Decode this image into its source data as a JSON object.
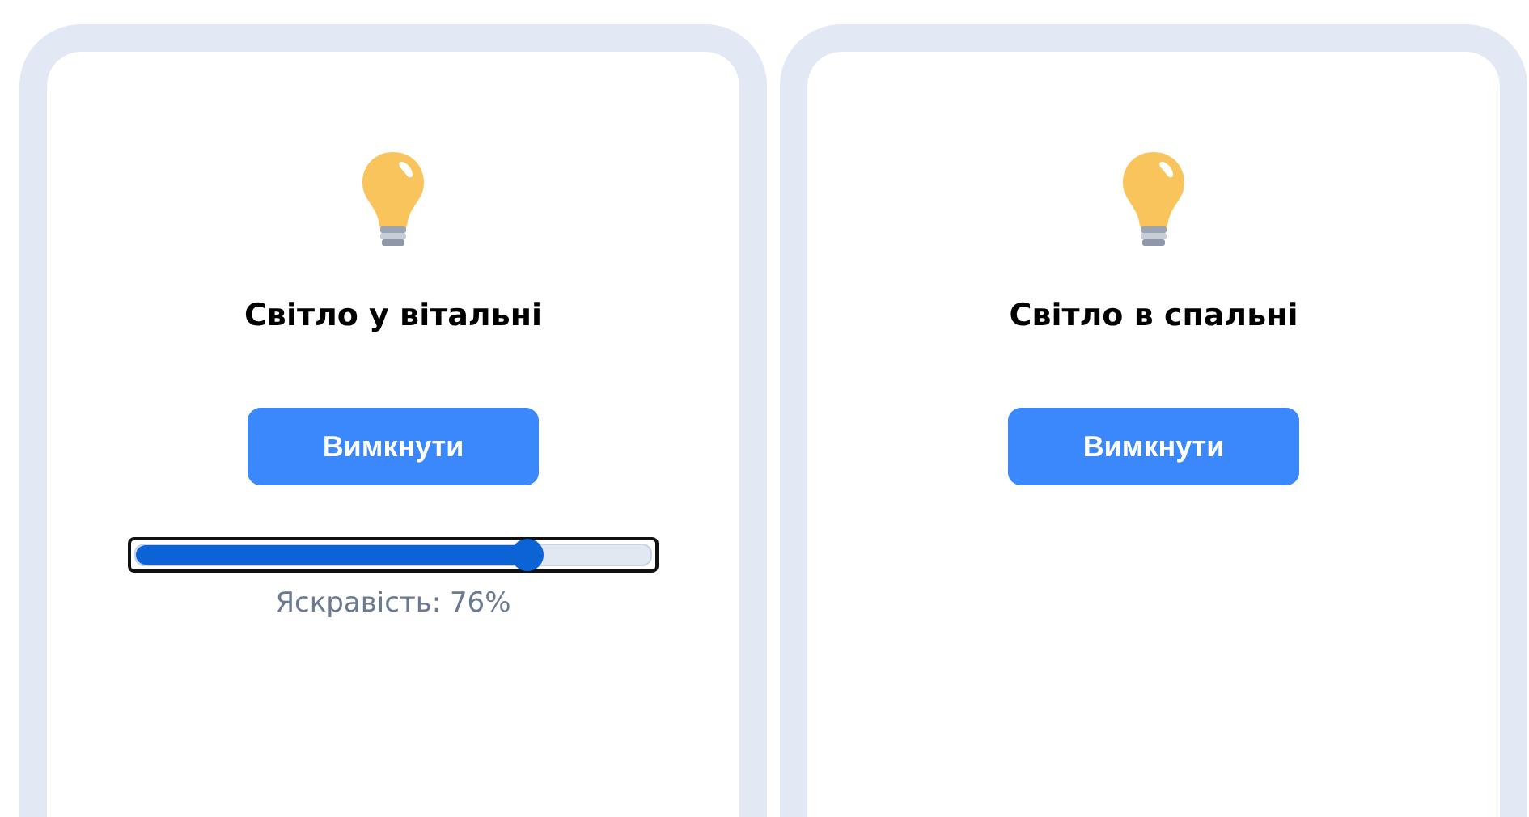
{
  "cards": [
    {
      "title": "Світло у вітальні",
      "button": "Вимкнути",
      "brightness": {
        "level": 0.76,
        "reading": "Яскравість: 76%"
      }
    },
    {
      "title": "Світло в спальні",
      "button": "Вимкнути"
    }
  ]
}
